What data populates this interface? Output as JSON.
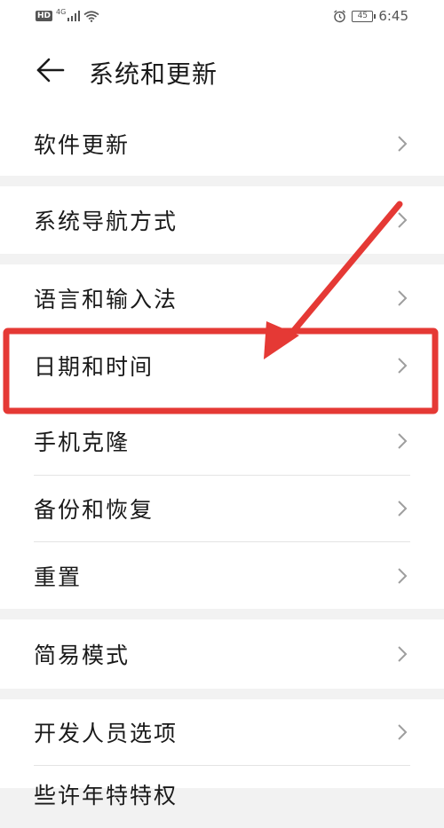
{
  "status_bar": {
    "hd": "HD",
    "network": "4G",
    "battery": "45",
    "time": "6:45",
    "icons": [
      "hd-icon",
      "signal-icon",
      "wifi-icon",
      "alarm-icon",
      "battery-icon"
    ]
  },
  "header": {
    "title": "系统和更新",
    "back_icon": "arrow-left-icon"
  },
  "items": [
    {
      "label": "软件更新"
    },
    {
      "label": "系统导航方式"
    },
    {
      "label": "语言和输入法"
    },
    {
      "label": "日期和时间"
    },
    {
      "label": "手机克隆"
    },
    {
      "label": "备份和恢复"
    },
    {
      "label": "重置"
    },
    {
      "label": "简易模式"
    },
    {
      "label": "开发人员选项"
    },
    {
      "label": "些许年特特权"
    }
  ],
  "annotation": {
    "highlight_color": "#e53935",
    "arrow_color": "#e53935"
  },
  "colors": {
    "background": "#f2f2f2",
    "card": "#ffffff",
    "text": "#1a1a1a",
    "chevron": "#9e9e9e"
  }
}
